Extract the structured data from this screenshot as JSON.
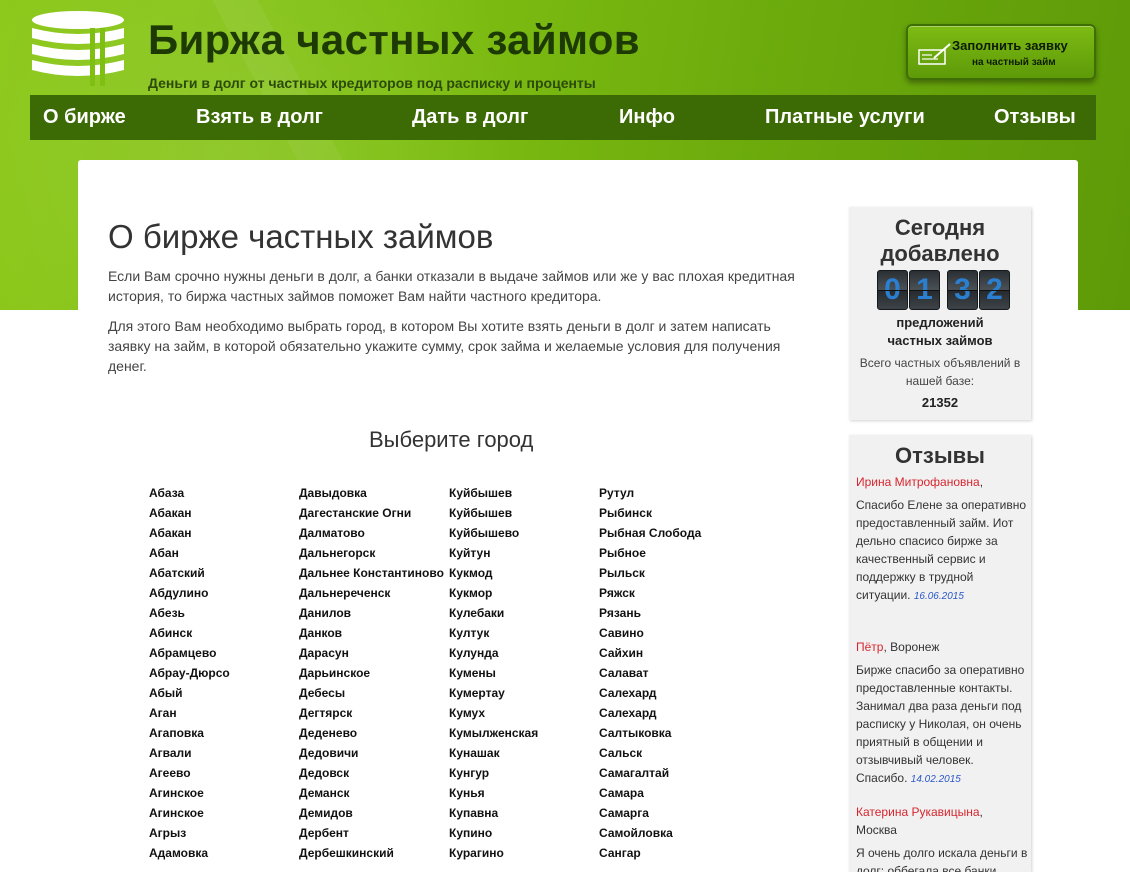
{
  "header": {
    "title": "Биржа частных займов",
    "subtitle": "Деньги в долг от частных кредиторов под расписку и проценты",
    "apply_button": {
      "line1": "Заполнить заявку",
      "line2": "на частный займ",
      "icon": "pen-form-icon"
    },
    "logo_icon": "coin-stack-icon"
  },
  "nav": {
    "items": [
      {
        "label": "О бирже"
      },
      {
        "label": "Взять в долг"
      },
      {
        "label": "Дать в долг"
      },
      {
        "label": "Инфо"
      },
      {
        "label": "Платные услуги"
      },
      {
        "label": "Отзывы"
      }
    ]
  },
  "main": {
    "title": "О бирже частных займов",
    "paragraph1": "Если Вам срочно нужны деньги в долг, а банки отказали в выдаче займов или же у вас плохая кредитная история, то биржа частных займов поможет Вам найти частного кредитора.",
    "paragraph2": "Для этого Вам необходимо выбрать город, в котором Вы хотите взять деньги в долг и затем написать заявку на займ, в которой обязательно укажите сумму, срок займа и желаемые условия для получения денег.",
    "choose_city": "Выберите город",
    "cities": [
      [
        "Абаза",
        "Абакан",
        "Абакан",
        "Абан",
        "Абатский",
        "Абдулино",
        "Абезь",
        "Абинск",
        "Абрамцево",
        "Абрау-Дюрсо",
        "Абый",
        "Аган",
        "Агаповка",
        "Агвали",
        "Агеево",
        "Агинское",
        "Агинское",
        "Агрыз",
        "Адамовка"
      ],
      [
        "Давыдовка",
        "Дагестанские Огни",
        "Далматово",
        "Дальнегорск",
        "Дальнее Константиново",
        "Дальнереченск",
        "Данилов",
        "Данков",
        "Дарасун",
        "Дарьинское",
        "Дебесы",
        "Дегтярск",
        "Деденево",
        "Дедовичи",
        "Дедовск",
        "Деманск",
        "Демидов",
        "Дербент",
        "Дербешкинский"
      ],
      [
        "Куйбышев",
        "Куйбышев",
        "Куйбышево",
        "Куйтун",
        "Кукмод",
        "Кукмор",
        "Кулебаки",
        "Култук",
        "Кулунда",
        "Кумены",
        "Кумертау",
        "Кумух",
        "Кумылженская",
        "Кунашак",
        "Кунгур",
        "Кунья",
        "Купавна",
        "Купино",
        "Курагино"
      ],
      [
        "Рутул",
        "Рыбинск",
        "Рыбная Слобода",
        "Рыбное",
        "Рыльск",
        "Ряжск",
        "Рязань",
        "Савино",
        "Сайхин",
        "Салават",
        "Салехард",
        "Салехард",
        "Салтыковка",
        "Сальск",
        "Самагалтай",
        "Самара",
        "Самарга",
        "Самойловка",
        "Сангар"
      ]
    ]
  },
  "sidebar": {
    "today": {
      "title_line1": "Сегодня",
      "title_line2": "добавлено",
      "digits": [
        "0",
        "1",
        "3",
        "2"
      ],
      "label_line1": "предложений",
      "label_line2": "частных займов",
      "total_line1": "Всего частных объявлений в",
      "total_line2": "нашей базе:",
      "total_value": "21352"
    },
    "reviews": {
      "title": "Отзывы",
      "items": [
        {
          "author": "Ирина Митрофановна",
          "location": "",
          "text": "Спасибо Елене за оперативно предоставленный займ. Иот дельно спасисо бирже за качественный сервис и поддержку в трудной ситуации.",
          "date": "16.06.2015"
        },
        {
          "author": "Пётр",
          "location": "Воронеж",
          "text": "Бирже спасибо за оперативно предоставленные контакты. Занимал два раза деньги под расписку у Николая, он очень приятный в общении и отзывчивый человек. Спасибо.",
          "date": "14.02.2015"
        },
        {
          "author": "Катерина Рукавицына",
          "location": "Москва",
          "text": "Я очень долго искала деньги в долг: оббегала все банки",
          "date": ""
        }
      ]
    }
  },
  "colors": {
    "header_green": "#7fbf12",
    "nav_dark_green": "#3c6a05",
    "title_dark_green": "#1d3a05",
    "counter_blue": "#2a7fd0",
    "review_author_red": "#d7262e",
    "review_date_blue": "#2a58c8"
  }
}
